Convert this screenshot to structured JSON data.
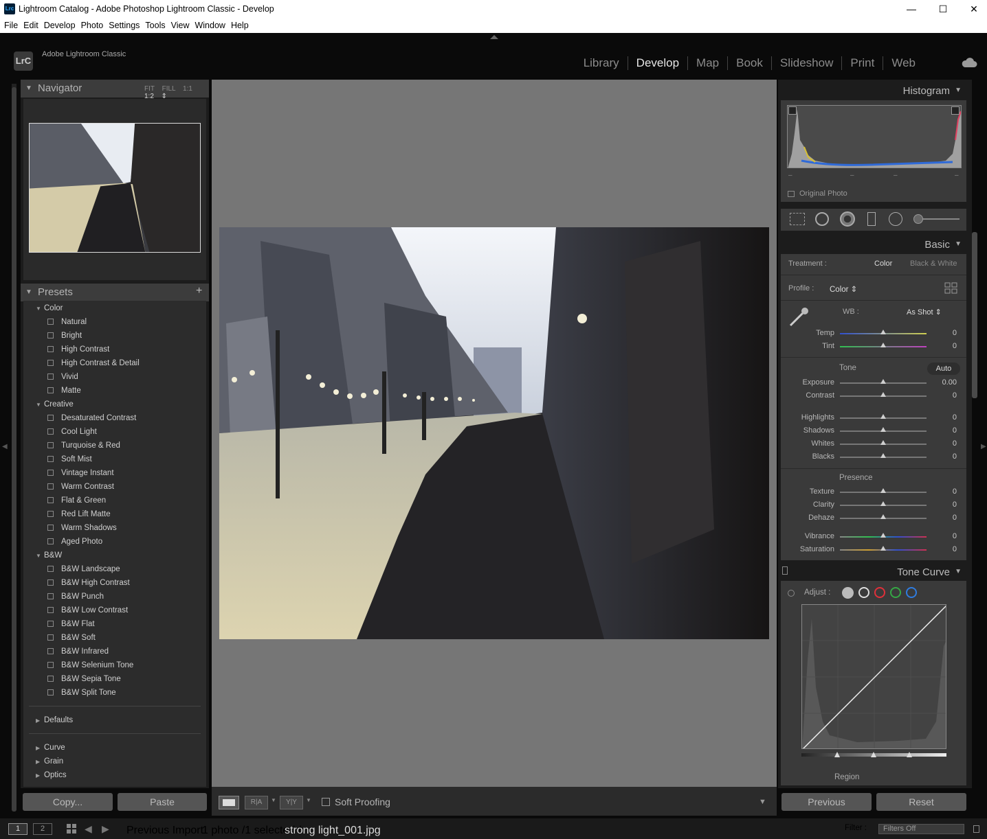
{
  "window": {
    "title": "Lightroom Catalog - Adobe Photoshop Lightroom Classic - Develop",
    "app_icon": "Lrc",
    "minimize": "—",
    "maximize": "☐",
    "close": "✕"
  },
  "menu": [
    "File",
    "Edit",
    "Develop",
    "Photo",
    "Settings",
    "Tools",
    "View",
    "Window",
    "Help"
  ],
  "identity": {
    "logo": "LrC",
    "app_name": "Adobe Lightroom Classic"
  },
  "modules": [
    {
      "label": "Library",
      "active": false
    },
    {
      "label": "Develop",
      "active": true
    },
    {
      "label": "Map",
      "active": false
    },
    {
      "label": "Book",
      "active": false
    },
    {
      "label": "Slideshow",
      "active": false
    },
    {
      "label": "Print",
      "active": false
    },
    {
      "label": "Web",
      "active": false
    }
  ],
  "navigator": {
    "title": "Navigator",
    "options": [
      "FIT",
      "FILL",
      "1:1",
      "1:2 ⇕"
    ]
  },
  "presets": {
    "title": "Presets",
    "add_icon": "+",
    "groups": [
      {
        "name": "Color",
        "items": [
          "Natural",
          "Bright",
          "High Contrast",
          "High Contrast & Detail",
          "Vivid",
          "Matte"
        ]
      },
      {
        "name": "Creative",
        "items": [
          "Desaturated Contrast",
          "Cool Light",
          "Turquoise & Red",
          "Soft Mist",
          "Vintage Instant",
          "Warm Contrast",
          "Flat & Green",
          "Red Lift Matte",
          "Warm Shadows",
          "Aged Photo"
        ]
      },
      {
        "name": "B&W",
        "items": [
          "B&W Landscape",
          "B&W High Contrast",
          "B&W Punch",
          "B&W Low Contrast",
          "B&W Flat",
          "B&W Soft",
          "B&W Infrared",
          "B&W Selenium Tone",
          "B&W Sepia Tone",
          "B&W Split Tone"
        ]
      }
    ],
    "collapsed": [
      "Defaults",
      "Curve",
      "Grain",
      "Optics"
    ]
  },
  "left_buttons": {
    "copy": "Copy...",
    "paste": "Paste"
  },
  "histogram": {
    "title": "Histogram",
    "original_photo": "Original Photo",
    "readouts": [
      "–",
      "–",
      "–",
      "–"
    ]
  },
  "basic": {
    "title": "Basic",
    "treatment_label": "Treatment :",
    "treatment_color": "Color",
    "treatment_bw": "Black & White",
    "profile_label": "Profile :",
    "profile_value": "Color ⇕",
    "wb_label": "WB :",
    "wb_value": "As Shot ⇕",
    "tone_label": "Tone",
    "auto": "Auto",
    "presence_label": "Presence",
    "sliders": {
      "temp": {
        "label": "Temp",
        "value": "0"
      },
      "tint": {
        "label": "Tint",
        "value": "0"
      },
      "exposure": {
        "label": "Exposure",
        "value": "0.00"
      },
      "contrast": {
        "label": "Contrast",
        "value": "0"
      },
      "highlights": {
        "label": "Highlights",
        "value": "0"
      },
      "shadows": {
        "label": "Shadows",
        "value": "0"
      },
      "whites": {
        "label": "Whites",
        "value": "0"
      },
      "blacks": {
        "label": "Blacks",
        "value": "0"
      },
      "texture": {
        "label": "Texture",
        "value": "0"
      },
      "clarity": {
        "label": "Clarity",
        "value": "0"
      },
      "dehaze": {
        "label": "Dehaze",
        "value": "0"
      },
      "vibrance": {
        "label": "Vibrance",
        "value": "0"
      },
      "saturation": {
        "label": "Saturation",
        "value": "0"
      }
    }
  },
  "tone_curve": {
    "title": "Tone Curve",
    "adjust_label": "Adjust :",
    "region_label": "Region"
  },
  "right_buttons": {
    "previous": "Previous",
    "reset": "Reset"
  },
  "toolbar": {
    "soft_proofing": "Soft Proofing",
    "ra": "R|A",
    "yy": "Y|Y"
  },
  "filmstrip": {
    "page1": "1",
    "page2": "2",
    "source": "Previous Import",
    "count": "1 photo /1 selected /",
    "filename": "strong light_001.jpg",
    "filter_label": "Filter :",
    "filter_value": "Filters Off"
  },
  "colors": {
    "accent_red": "#e0303a",
    "accent_green": "#35a845",
    "accent_blue": "#2f7ce0"
  }
}
